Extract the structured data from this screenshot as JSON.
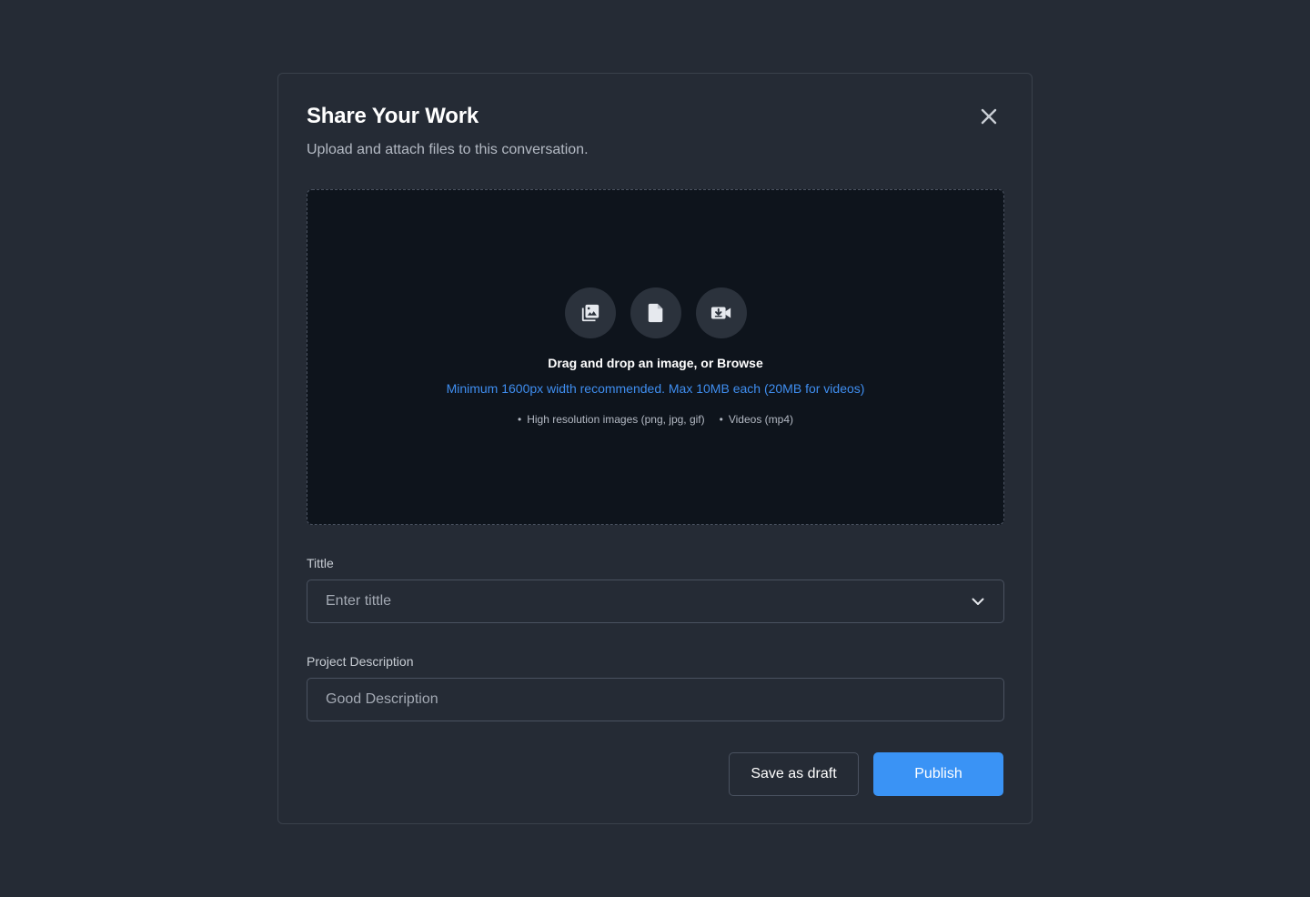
{
  "modal": {
    "title": "Share Your Work",
    "subtitle": "Upload and attach files to this conversation.",
    "close_icon": "close-icon"
  },
  "dropzone": {
    "icons": [
      "image-gallery-icon",
      "document-icon",
      "video-import-icon"
    ],
    "main_text": "Drag and drop an image, or Browse",
    "hint_text": "Minimum 1600px width recommended. Max 10MB each (20MB for videos)",
    "types": [
      "High resolution images (png, jpg, gif)",
      "Videos (mp4)"
    ]
  },
  "fields": {
    "title_label": "Tittle",
    "title_placeholder": "Enter tittle",
    "description_label": "Project Description",
    "description_placeholder": "Good Description"
  },
  "actions": {
    "draft_label": "Save as draft",
    "publish_label": "Publish"
  },
  "colors": {
    "background": "#252b35",
    "dropzone": "#0e141c",
    "accent": "#3a93f5",
    "hint": "#3f8ef0"
  }
}
